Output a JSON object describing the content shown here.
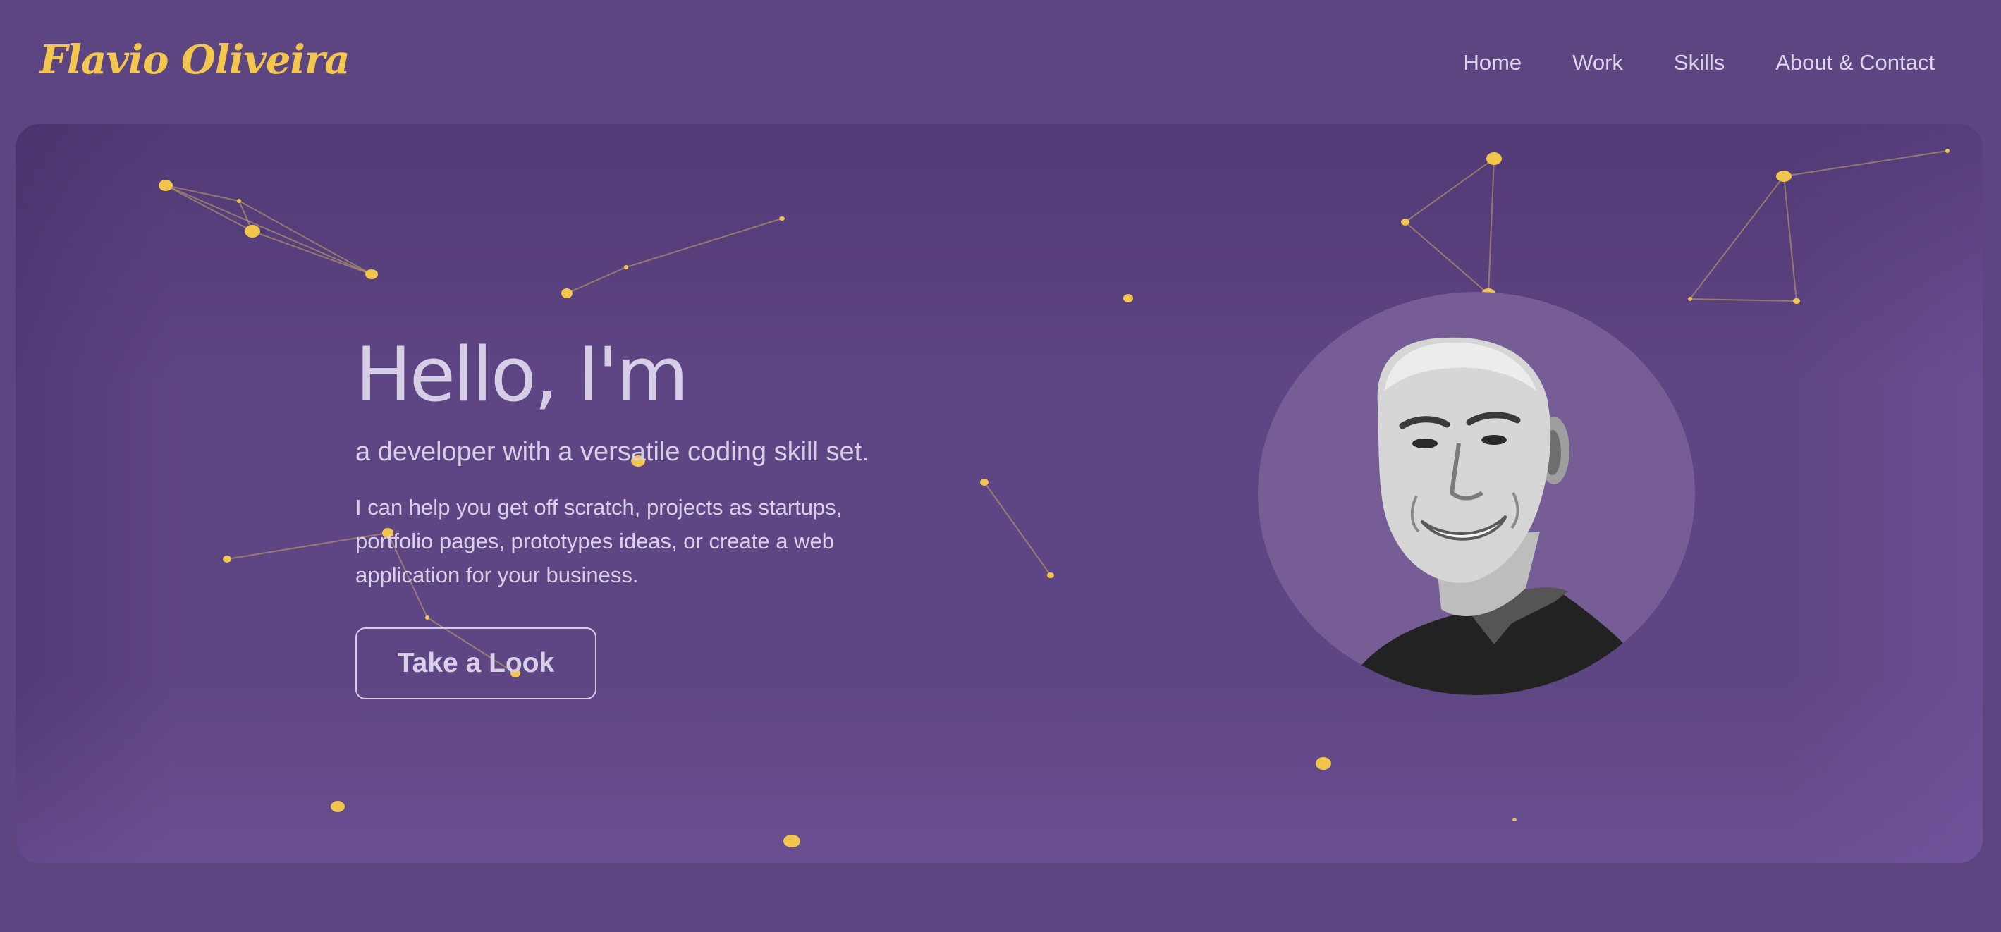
{
  "header": {
    "logo": "Flavio Oliveira",
    "nav": [
      "Home",
      "Work",
      "Skills",
      "About & Contact"
    ]
  },
  "hero": {
    "title": "Hello, I'm",
    "subtitle": "a developer with a versatile coding skill set.",
    "description": "I can help you get off scratch, projects as startups, portfolio pages, prototypes ideas, or create a web application for your business.",
    "cta_label": "Take a Look"
  },
  "colors": {
    "background": "#5c4581",
    "hero_background": "#5e4583",
    "accent": "#f3c64f",
    "text": "#d6cee6",
    "avatar_circle": "#765d96"
  }
}
